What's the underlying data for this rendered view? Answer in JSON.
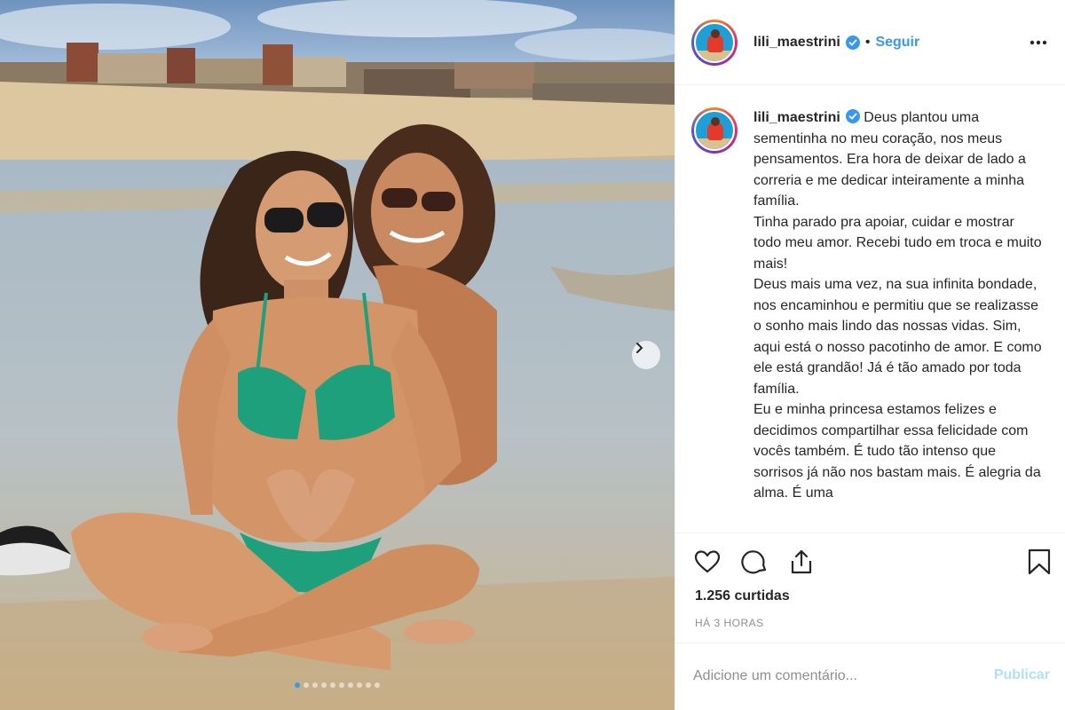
{
  "post": {
    "username": "lili_maestrini",
    "follow_separator": "•",
    "follow_label": "Seguir",
    "caption": "Deus plantou uma sementinha no meu coração, nos meus pensamentos. Era hora de deixar de lado a correria e me dedicar inteiramente a minha família.\nTinha parado pra apoiar, cuidar e mostrar todo meu amor. Recebi tudo em troca e muito mais!\nDeus mais uma vez, na sua infinita bondade, nos encaminhou e permitiu que se realizasse o sonho mais lindo das nossas vidas. Sim, aqui está o nosso pacotinho de amor. E como ele está grandão! Já é tão amado por toda família.\nEu e minha princesa estamos felizes e decidimos compartilhar essa felicidade com vocês também. É tudo tão intenso que sorrisos já não nos bastam mais. É alegria da alma. É uma",
    "likes": "1.256 curtidas",
    "time": "HÁ 3 HORAS",
    "comment_placeholder": "Adicione um comentário...",
    "publish_label": "Publicar",
    "carousel_count": 10,
    "carousel_active": 1
  },
  "icons": {
    "verified": "verified-badge-icon",
    "more": "more-options-icon",
    "like": "heart-icon",
    "comment": "comment-icon",
    "share": "share-icon",
    "save": "bookmark-icon",
    "next": "chevron-right-icon"
  },
  "colors": {
    "accent": "#3897f0",
    "publish_disabled": "#b2dffc",
    "muted": "#8e8e8e",
    "bikini": "#1fa07c"
  }
}
